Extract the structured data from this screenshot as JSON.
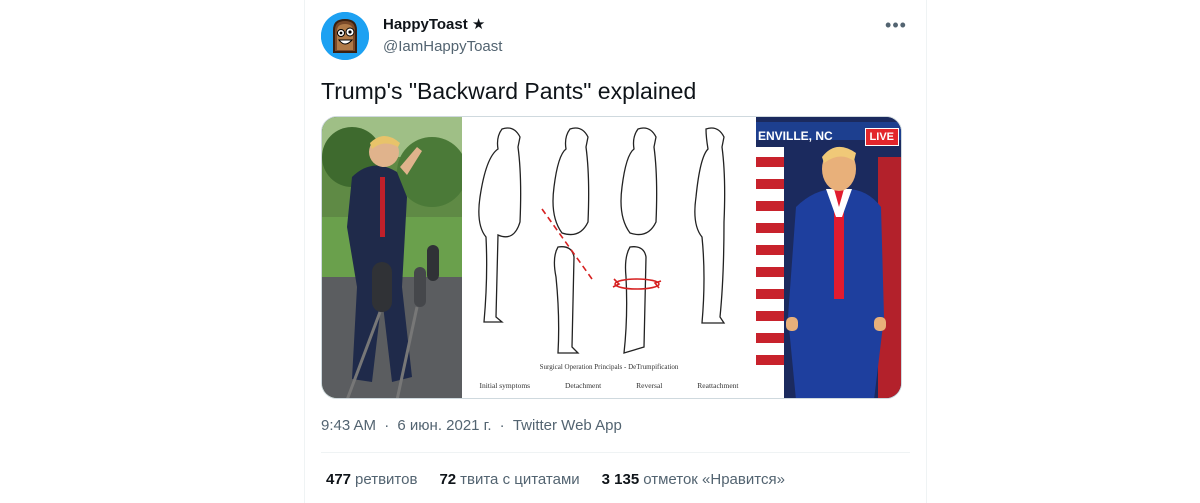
{
  "author": {
    "display_name": "HappyToast",
    "badge": "★",
    "handle": "@IamHappyToast",
    "avatar_icon": "toast-face-avatar"
  },
  "more_label": "•••",
  "tweet_text": "Trump's \"Backward Pants\" explained",
  "media": {
    "diagram_title": "Surgical Operation Principals - DeTrumpification",
    "steps": [
      "Initial symptoms",
      "Detachment",
      "Reversal",
      "Reattachment"
    ],
    "broadcast_city": "ENVILLE, NC",
    "broadcast_live": "LIVE"
  },
  "meta": {
    "time": "9:43 AM",
    "date": "6 июн. 2021 г.",
    "source": "Twitter Web App"
  },
  "stats": {
    "retweets_count": "477",
    "retweets_label": "ретвитов",
    "quotes_count": "72",
    "quotes_label": "твита с цитатами",
    "likes_count": "3 135",
    "likes_label": "отметок «Нравится»"
  },
  "colors": {
    "accent": "#1da1f2",
    "text": "#0f1419",
    "muted": "#536471",
    "live_red": "#e3262b"
  }
}
